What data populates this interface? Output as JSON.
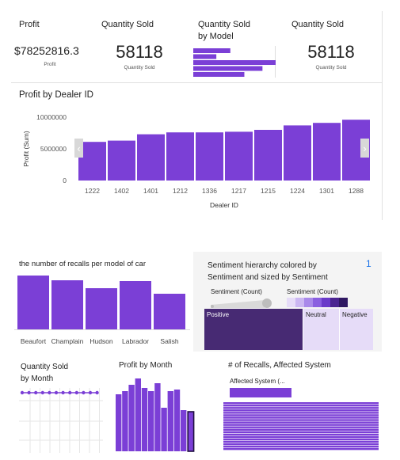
{
  "kpis": {
    "profit": {
      "title": "Profit",
      "value": "$78252816.3",
      "caption": "Profit"
    },
    "qty1": {
      "title": "Quantity Sold",
      "value": "58118",
      "caption": "Quantity Sold"
    },
    "qty_model": {
      "title_line1": "Quantity Sold",
      "title_line2": "by Model"
    },
    "qty2": {
      "title": "Quantity Sold",
      "value": "58118",
      "caption": "Quantity Sold"
    }
  },
  "dealer_chart": {
    "title": "Profit by Dealer ID",
    "nav_prev": "‹",
    "nav_next": "›"
  },
  "recalls_chart": {
    "title": "the number of recalls per model of car"
  },
  "sentiment": {
    "title_line1": "Sentiment hierarchy colored by",
    "title_line2": "Sentiment and sized by Sentiment",
    "badge": "1",
    "legend_size": "Sentiment (Count)",
    "legend_color": "Sentiment (Count)",
    "colors": [
      "#e6dcf8",
      "#cbb7f2",
      "#a989ea",
      "#8a5fe0",
      "#6a3bc9",
      "#4b2591",
      "#2f1862"
    ],
    "segments": [
      {
        "label": "Positive",
        "color": "#472a73"
      },
      {
        "label": "Neutral",
        "color": "#e6dcf8"
      },
      {
        "label": "Negative",
        "color": "#e6dcf8"
      }
    ]
  },
  "qty_month": {
    "title_line1": "Quantity Sold",
    "title_line2": "by Month"
  },
  "profit_month": {
    "title": "Profit by Month"
  },
  "recalls_system": {
    "title": "# of Recalls, Affected System",
    "legend": "Affected System (..."
  },
  "accent": "#7b3fd6",
  "chart_data": [
    {
      "type": "bar",
      "title": "Profit by Dealer ID",
      "xlabel": "Dealer ID",
      "ylabel": "Profit (Sum)",
      "categories": [
        "1222",
        "1402",
        "1401",
        "1212",
        "1336",
        "1217",
        "1215",
        "1224",
        "1301",
        "1288"
      ],
      "values": [
        6100000,
        6300000,
        7300000,
        7600000,
        7600000,
        7700000,
        8000000,
        8700000,
        9100000,
        9600000
      ],
      "ylim": [
        0,
        10000000
      ],
      "yticks": [
        "10000000",
        "5000000",
        "0"
      ],
      "grid": false
    },
    {
      "type": "bar",
      "title": "the number of recalls per model of car",
      "categories": [
        "Beaufort",
        "Champlain",
        "Hudson",
        "Labrador",
        "Salish"
      ],
      "values": [
        68,
        62,
        52,
        61,
        45
      ],
      "ylim": [
        0,
        70
      ]
    },
    {
      "type": "bar",
      "title": "Quantity Sold by Model",
      "orientation": "horizontal",
      "values": [
        45,
        28,
        100,
        84,
        62
      ]
    },
    {
      "type": "line",
      "title": "Quantity Sold by Month",
      "values": [
        10,
        10,
        10,
        10,
        10,
        10,
        10,
        10,
        10,
        10,
        10,
        10
      ]
    },
    {
      "type": "bar",
      "title": "Profit by Month",
      "values": [
        72,
        76,
        84,
        92,
        80,
        76,
        86,
        55,
        76,
        78,
        52
      ]
    },
    {
      "type": "bar",
      "title": "# of Recalls, Affected System",
      "orientation": "horizontal"
    }
  ]
}
